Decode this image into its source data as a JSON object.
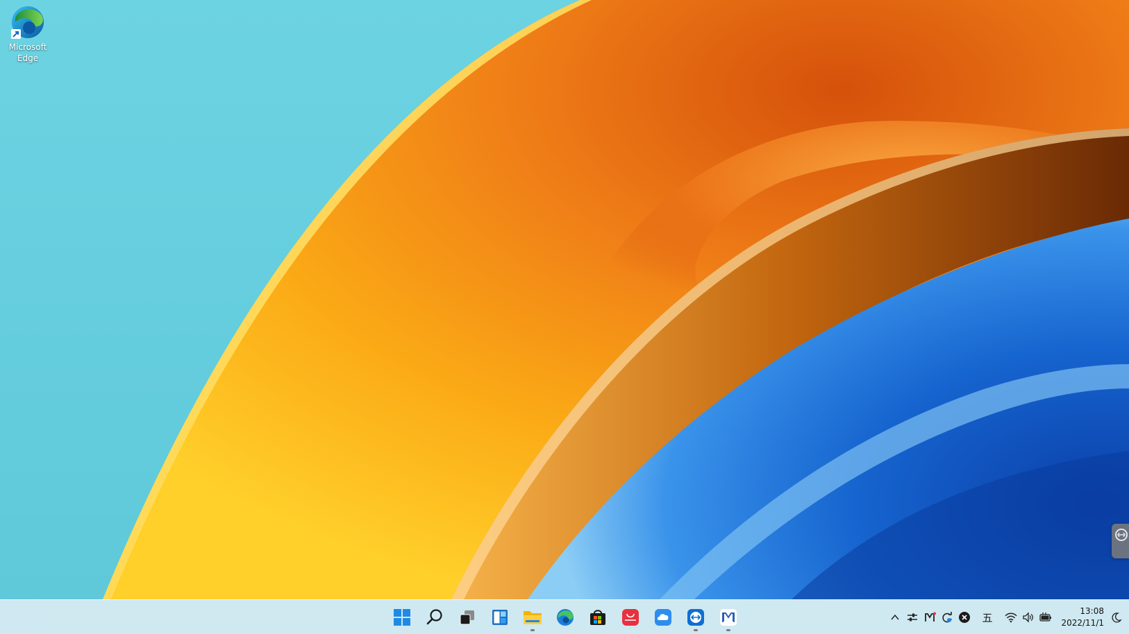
{
  "desktop": {
    "icons": [
      {
        "label": "Microsoft Edge",
        "icon": "edge-icon",
        "shortcut": true
      }
    ]
  },
  "taskbar": {
    "pinned": [
      {
        "name": "start",
        "icon": "windows-logo-icon",
        "running": false
      },
      {
        "name": "search",
        "icon": "search-icon",
        "running": false
      },
      {
        "name": "task-view",
        "icon": "task-view-icon",
        "running": false
      },
      {
        "name": "widgets",
        "icon": "widgets-icon",
        "running": false
      },
      {
        "name": "file-explorer",
        "icon": "folder-icon",
        "running": true
      },
      {
        "name": "microsoft-edge",
        "icon": "edge-icon",
        "running": false
      },
      {
        "name": "microsoft-store",
        "icon": "store-icon",
        "running": false
      },
      {
        "name": "huawei-appgallery",
        "icon": "huawei-appgallery-icon",
        "running": false
      },
      {
        "name": "cloud-drive",
        "icon": "cloud-icon",
        "running": false
      },
      {
        "name": "teamviewer",
        "icon": "teamviewer-icon",
        "running": true
      },
      {
        "name": "huawei-pc-manager",
        "icon": "pc-manager-icon",
        "running": true
      }
    ],
    "tray": {
      "icons": [
        "chevron-up-icon",
        "sliders-icon",
        "pc-manager-tray-icon",
        "sync-icon",
        "close-circle-icon"
      ],
      "ime_label": "五",
      "status_icons": [
        "wifi-icon",
        "volume-icon",
        "battery-plug-icon"
      ]
    },
    "clock": {
      "time": "13:08",
      "date": "2022/11/1"
    }
  },
  "colors": {
    "sky": "#68d1df",
    "orange": "#f28a1c",
    "yellow": "#ffc21a",
    "blue": "#1a6fd6",
    "taskbar": "#e2eef4"
  }
}
